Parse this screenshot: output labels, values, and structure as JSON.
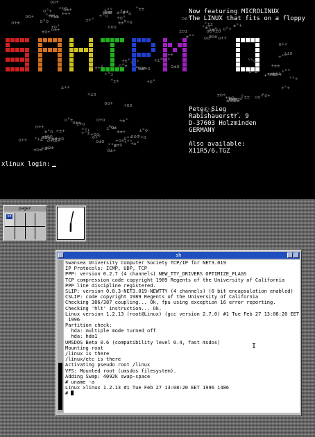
{
  "console": {
    "announce_1": "Now featuring MICROLINUX",
    "announce_2": "The LINUX that fits on a floppy",
    "address": [
      "Peter Sieg",
      "Rabishauerstr. 9",
      "D-37603 Holzminden",
      "GERMANY"
    ],
    "also_1": "Also available:",
    "also_2": "X11R5/6.TGZ",
    "login_prompt": "xlinux login:",
    "fill_glyphs": "o+±°",
    "logo_colors": [
      "#d02020",
      "#d07020",
      "#d0c020",
      "#20b020",
      "#2040d0",
      "#a020c0",
      "#ffffff"
    ]
  },
  "pager": {
    "title": "pager",
    "mini_label": "sh"
  },
  "clock": {
    "hour": 6,
    "minute": 2
  },
  "xterm": {
    "title": "sh",
    "lines": [
      "Swansea University Computer Society TCP/IP for NET3.019",
      "IP Protocols: ICMP, UDP, TCP",
      "PPP: version 0.2.7 (4 channels) NEW_TTY_DRIVERS OPTIMIZE_FLAGS",
      "TCP compression code copyright 1989 Regents of the University of California",
      "PPP line discipline registered.",
      "SLIP: version 0.8.3-NET3.019-NEWTTY (4 channels) (6 bit encapsulation enabled)",
      "CSLIP: code copyright 1989 Regents of the University of California",
      "Checking 386/387 coupling... Ok, fpu using exception 16 error reporting.",
      "Checking 'hlt' instruction... Ok.",
      "Linux version 1.2.13 (root@Linux) (gcc version 2.7.0) #1 Tue Feb 27 13:08:20 EET",
      " 1996",
      "Partition check:",
      "  hda: multiple mode turned off",
      "  hda: hda1",
      "UMSDOS Beta 0.6 (compatibility level 0.4, fast msdos)",
      "Mounting root",
      "/linux is there",
      "/linux/etc is there",
      "Activating pseudo root /linux",
      "VFS: Mounted root (umsdos filesystem).",
      "Adding Swap: 4092k swap-space",
      "# uname -a",
      "Linux xlinux 1.2.13 #1 Tue Feb 27 13:08:20 EET 1996 i486",
      "# "
    ]
  }
}
